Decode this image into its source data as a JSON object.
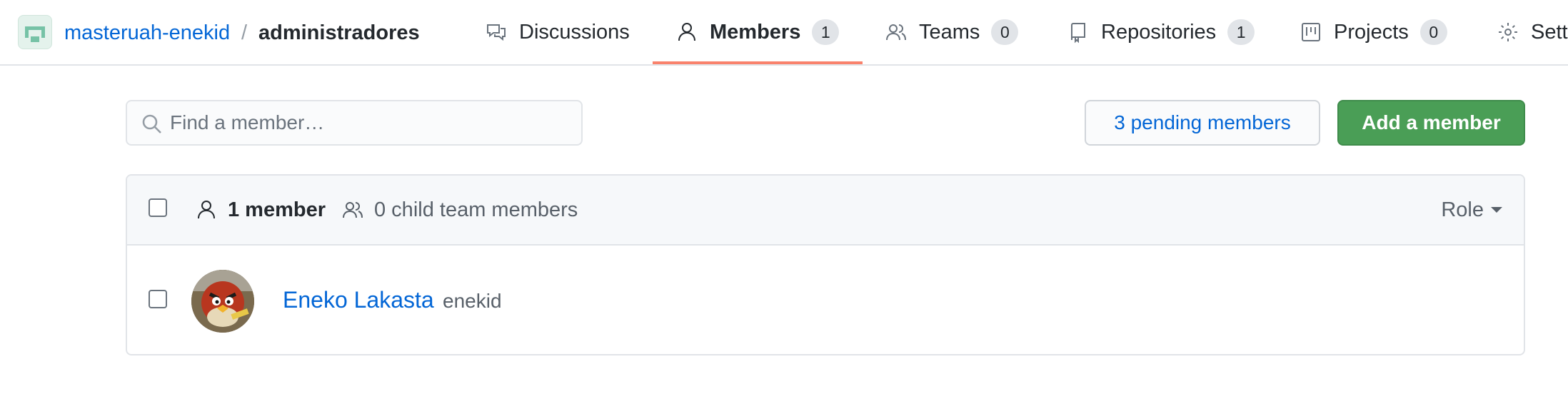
{
  "header": {
    "org_name": "masteruah-enekid",
    "separator": "/",
    "team_name": "administradores",
    "tabs": [
      {
        "label": "Discussions",
        "icon": "discussions-icon"
      },
      {
        "label": "Members",
        "count": "1",
        "icon": "person-icon",
        "active": true
      },
      {
        "label": "Teams",
        "count": "0",
        "icon": "people-icon"
      },
      {
        "label": "Repositories",
        "count": "1",
        "icon": "repo-icon"
      },
      {
        "label": "Projects",
        "count": "0",
        "icon": "project-icon"
      },
      {
        "label": "Sett",
        "icon": "gear-icon"
      }
    ]
  },
  "toolbar": {
    "search_placeholder": "Find a member…",
    "pending_label": "3 pending members",
    "add_label": "Add a member"
  },
  "members": {
    "count_label": "1 member",
    "child_label": "0 child team members",
    "role_label": "Role",
    "rows": [
      {
        "name": "Eneko Lakasta",
        "login": "enekid"
      }
    ]
  },
  "colors": {
    "link": "#0366d6",
    "primary_button": "#4a9e56",
    "active_tab_underline": "#f9826c"
  }
}
